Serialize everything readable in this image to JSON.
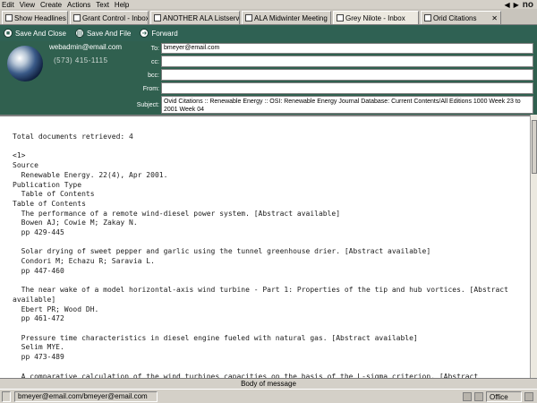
{
  "menu": {
    "items": [
      "Edit",
      "View",
      "Create",
      "Actions",
      "Text",
      "Help"
    ],
    "logo": "no"
  },
  "tabs": [
    {
      "label": "Show Headlines",
      "active": false
    },
    {
      "label": "Grant Control - Inbox",
      "active": false
    },
    {
      "label": "ANOTHER ALA Listserv Archive",
      "active": false
    },
    {
      "label": "ALA Midwinter Meeting",
      "active": false
    },
    {
      "label": "Grey Nilote - Inbox",
      "active": true
    },
    {
      "label": "Orid Citations",
      "active": false
    }
  ],
  "toolbar": {
    "save_close": "Save And Close",
    "save_file": "Save And File",
    "forward": "Forward"
  },
  "header": {
    "from": "webadmin@email.com",
    "phone": "(573) 415-1115",
    "labels": {
      "to": "To:",
      "cc": "cc:",
      "bcc": "bcc:",
      "from": "From:",
      "subject": "Subject:"
    },
    "to_value": "bmeyer@email.com",
    "cc_value": "",
    "bcc_value": "",
    "from_value": "",
    "subject_value": "Ovid Citations :: Renewable Energy :: OSI: Renewable Energy Journal Database: Current Contents/All Editions 1000 Week 23 to 2001 Week 04"
  },
  "body_text": "Total documents retrieved: 4\n\n<1>\nSource\n  Renewable Energy. 22(4), Apr 2001.\nPublication Type\n  Table of Contents\nTable of Contents\n  The performance of a remote wind-diesel power system. [Abstract available]\n  Bowen AJ; Cowie M; Zakay N.\n  pp 429-445\n\n  Solar drying of sweet pepper and garlic using the tunnel greenhouse drier. [Abstract available]\n  Condori M; Echazu R; Saravia L.\n  pp 447-460\n\n  The near wake of a model horizontal-axis wind turbine - Part 1: Properties of the tip and hub vortices. [Abstract\navailable]\n  Ebert PR; Wood DH.\n  pp 461-472\n\n  Pressure time characteristics in diesel engine fueled with natural gas. [Abstract available]\n  Selim MYE.\n  pp 473-489\n\n  A comparative calculation of the wind turbines capacities on the basis of the L-sigma criterion. [Abstract\navailable]\n  Bowen AJ; Yaldeb AS; Bowen R.",
  "body_label": "Body of message",
  "status": {
    "address": "bmeyer@email.com/bmeyer@email.com",
    "office": "Office"
  }
}
